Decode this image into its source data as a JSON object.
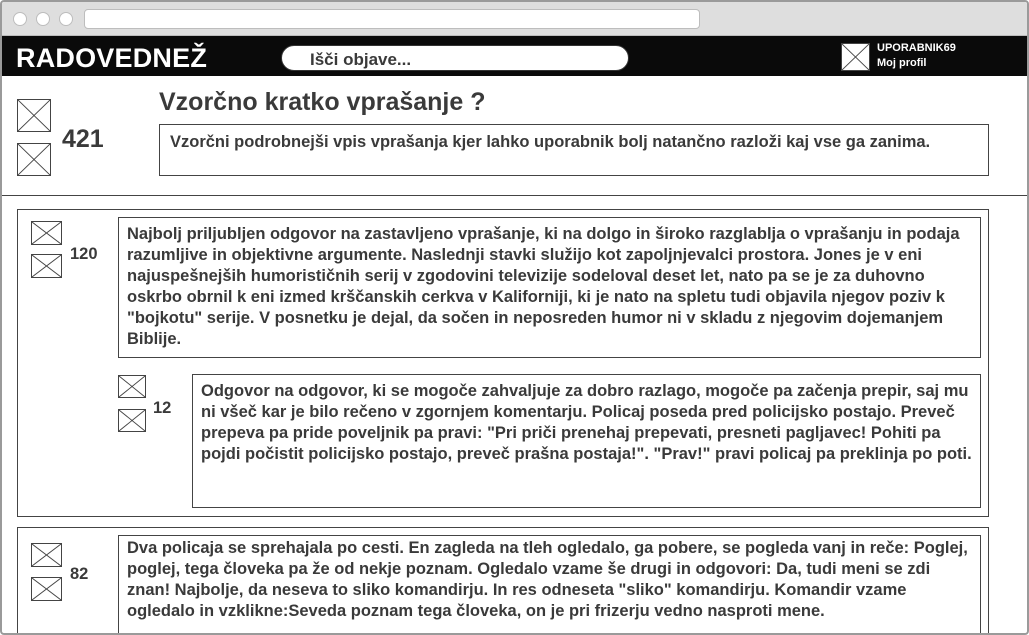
{
  "header": {
    "logo": "RADOVEDNEŽ",
    "search_placeholder": "Išči objave...",
    "user": {
      "name": "UPORABNIK69",
      "profile_link": "Moj profil"
    }
  },
  "question": {
    "title": "Vzorčno kratko vprašanje ?",
    "votes": "421",
    "body": "Vzorčni podrobnejši vpis vprašanja kjer lahko uporabnik bolj natančno razloži kaj vse ga zanima."
  },
  "answers": [
    {
      "votes": "120",
      "text": "Najbolj priljubljen odgovor na zastavljeno vprašanje, ki na dolgo in široko razglablja o vprašanju in podaja razumljive in objektivne argumente. Naslednji stavki služijo kot zapoljnjevalci prostora. Jones je v eni najuspešnejših humorističnih serij v zgodovini televizije sodeloval deset let, nato pa se je za duhovno oskrbo obrnil k eni izmed krščanskih cerkva v Kaliforniji, ki je nato na spletu tudi objavila njegov poziv k \"bojkotu\" serije. V posnetku je dejal, da sočen in neposreden humor ni v skladu z njegovim dojemanjem Biblije.",
      "reply": {
        "votes": "12",
        "text": "Odgovor na odgovor, ki se mogoče zahvaljuje za dobro razlago, mogoče pa začenja prepir, saj mu ni všeč kar je bilo rečeno v zgornjem komentarju. Policaj poseda pred policijsko postajo. Preveč prepeva pa pride poveljnik pa pravi: \"Pri priči prenehaj prepevati, presneti pagljavec! Pohiti pa pojdi počistit policijsko postajo, preveč prašna postaja!\". \"Prav!\" pravi policaj pa preklinja po poti."
      }
    },
    {
      "votes": "82",
      "text": "Dva policaja se sprehajala po cesti. En zagleda na tleh ogledalo, ga pobere, se pogleda vanj in reče: Poglej, poglej, tega človeka pa že od nekje poznam. Ogledalo vzame še drugi in odgovori: Da, tudi meni se zdi znan! Najbolje, da neseva to sliko komandirju. In res odneseta \"sliko\" komandirju. Komandir vzame ogledalo in vzklikne:Seveda poznam tega človeka, on je pri frizerju vedno nasproti mene."
    }
  ]
}
